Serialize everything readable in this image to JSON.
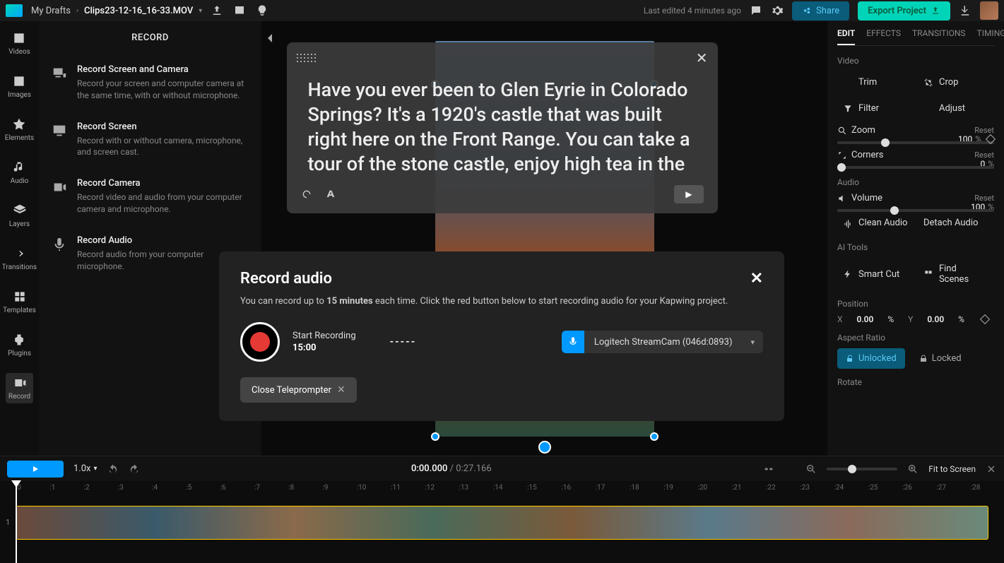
{
  "topbar": {
    "drafts": "My Drafts",
    "clip": "Clips23-12-16_16-33.MOV",
    "last_edit": "Last edited 4 minutes ago",
    "share": "Share",
    "export": "Export Project"
  },
  "leftnav": [
    {
      "label": "Videos"
    },
    {
      "label": "Images"
    },
    {
      "label": "Elements"
    },
    {
      "label": "Audio"
    },
    {
      "label": "Layers"
    },
    {
      "label": "Transitions"
    },
    {
      "label": "Templates"
    },
    {
      "label": "Plugins"
    },
    {
      "label": "Record"
    }
  ],
  "panel": {
    "title": "RECORD",
    "options": [
      {
        "t": "Record Screen and Camera",
        "d": "Record your screen and computer camera at the same time, with or without microphone."
      },
      {
        "t": "Record Screen",
        "d": "Record with or without camera, microphone, and screen cast."
      },
      {
        "t": "Record Camera",
        "d": "Record video and audio from your computer camera and microphone."
      },
      {
        "t": "Record Audio",
        "d": "Record audio from your computer microphone."
      }
    ]
  },
  "teleprompter": {
    "text": "Have you ever been to Glen Eyrie in Colorado Springs? It's a 1920's castle that was built right here on the Front Range. You can take a tour of the stone castle, enjoy high tea in the"
  },
  "rec_modal": {
    "title": "Record audio",
    "desc_pre": "You can record up to ",
    "desc_bold": "15 minutes",
    "desc_post": " each time. Click the red button below to start recording audio for your Kapwing project.",
    "start": "Start Recording",
    "time": "15:00",
    "wave": "-----",
    "mic": "Logitech StreamCam (046d:0893)",
    "close_telep": "Close Teleprompter"
  },
  "right": {
    "tabs": [
      "EDIT",
      "EFFECTS",
      "TRANSITIONS",
      "TIMING"
    ],
    "video": "Video",
    "trim": "Trim",
    "crop": "Crop",
    "filter": "Filter",
    "adjust": "Adjust",
    "zoom": "Zoom",
    "zoom_val": "100",
    "reset": "Reset",
    "corners": "Corners",
    "corners_val": "0",
    "audio": "Audio",
    "volume": "Volume",
    "volume_val": "100",
    "clean": "Clean Audio",
    "detach": "Detach Audio",
    "ai": "AI Tools",
    "smartcut": "Smart Cut",
    "findscenes": "Find Scenes",
    "position": "Position",
    "x": "X",
    "xval": "0.00",
    "y": "Y",
    "yval": "0.00",
    "aspect": "Aspect Ratio",
    "unlocked": "Unlocked",
    "locked": "Locked",
    "rotate": "Rotate",
    "pct": "%"
  },
  "controls": {
    "speed": "1.0x",
    "cur": "0:00.000",
    "tot": "/ 0:27.166",
    "fit": "Fit to Screen"
  },
  "ruler": [
    ":0",
    ":1",
    ":2",
    ":3",
    ":4",
    ":5",
    ":6",
    ":7",
    ":8",
    ":9",
    ":10",
    ":11",
    ":12",
    ":13",
    ":14",
    ":15",
    ":16",
    ":17",
    ":18",
    ":19",
    ":20",
    ":21",
    ":22",
    ":23",
    ":24",
    ":25",
    ":26",
    ":27",
    ":28"
  ],
  "track_num": "1"
}
